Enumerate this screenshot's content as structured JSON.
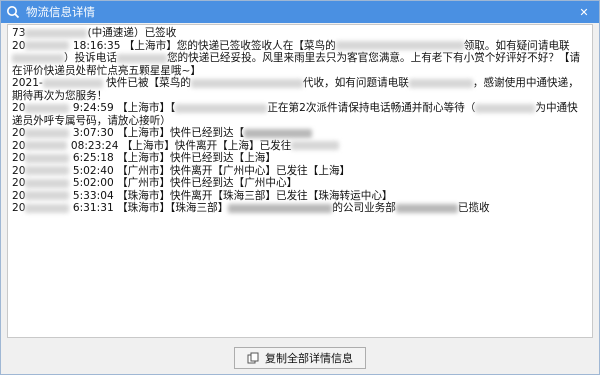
{
  "window": {
    "title": "物流信息详情",
    "close_glyph": "✕"
  },
  "log": {
    "header": {
      "prefix": "73",
      "suffix": "(中通速递）已签收"
    },
    "entries": [
      {
        "date_prefix": "20",
        "time": "18:16:35",
        "text": "【上海市】您的快递已签收签收人在【菜鸟的",
        "mid": "领取。如有疑问请电联",
        "cont": "）投诉电话",
        "cont2": "您的快递已经妥投。风里来雨里去只为客官您满意。上有老下有小赏个好评好不好？【请在评价快递员处帮忙点亮五颗星星哦~】"
      },
      {
        "date_prefix": "2021-",
        "text": "快件已被【菜鸟的",
        "mid": "代收，如有问题请电联",
        "tail": "，感谢使用中通快递，期待再次为您服务！"
      },
      {
        "date_prefix": "20",
        "time": "9:24:59",
        "text": "【上海市】【",
        "mid": "正在第2次派件请保持电话畅通并耐心等待（",
        "tail": "为中通快递员外呼专属号码，请放心接听）"
      },
      {
        "date_prefix": "20",
        "time": "3:07:30",
        "text": "【上海市】快件已经到达【"
      },
      {
        "date_prefix": "20",
        "time": "08:23:24",
        "text": "【上海市】快件离开【上海】已发往"
      },
      {
        "date_prefix": "20",
        "time": "6:25:18",
        "text": "【上海市】快件已经到达【上海】"
      },
      {
        "date_prefix": "20",
        "time": "5:02:40",
        "text": "【广州市】快件离开【广州中心】已发往【上海】"
      },
      {
        "date_prefix": "20",
        "time": "5:02:00",
        "text": "【广州市】快件已经到达【广州中心】"
      },
      {
        "date_prefix": "20",
        "time": "5:33:04",
        "text": "【珠海市】快件离开【珠海三部】已发往【珠海转运中心】"
      },
      {
        "date_prefix": "20",
        "time": "6:31:31",
        "text": "【珠海市】【珠海三部】",
        "mid": "的公司业务部",
        "tail": "已揽收"
      }
    ]
  },
  "footer": {
    "copy_button_label": "复制全部详情信息"
  },
  "colors": {
    "titlebar": "#4a90e2",
    "window_bg": "#f0f0f0",
    "content_bg": "#ffffff"
  },
  "icons": {
    "app": "search-truck-icon",
    "close": "close-icon",
    "copy": "copy-icon"
  }
}
